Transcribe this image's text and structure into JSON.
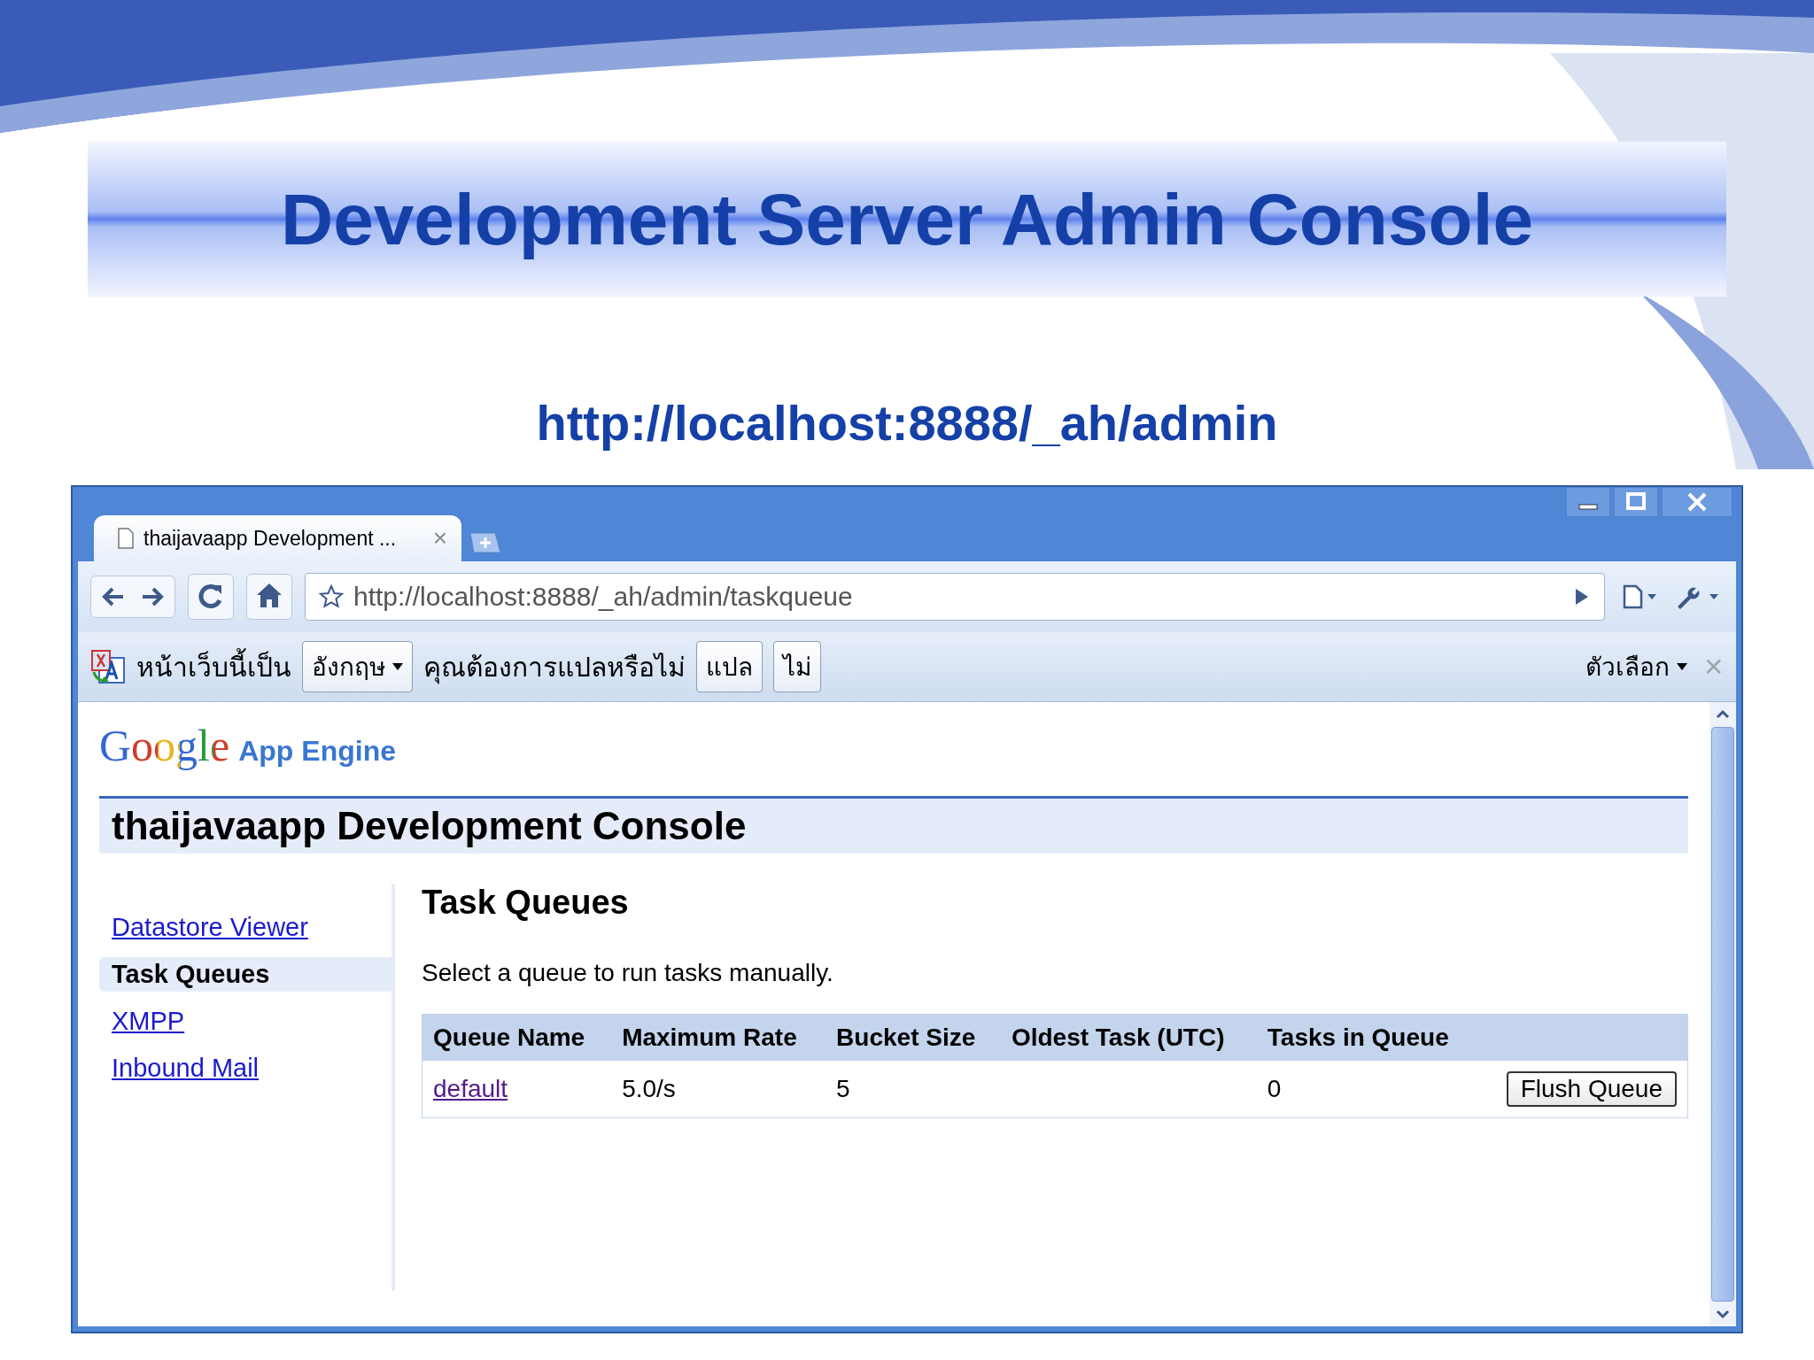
{
  "slide": {
    "title": "Development Server Admin Console",
    "subtitle": "http://localhost:8888/_ah/admin"
  },
  "browser": {
    "tab": {
      "title": "thaijavaapp Development ...",
      "close": "×"
    },
    "address": {
      "value": "http://localhost:8888/_ah/admin/taskqueue"
    },
    "translate_bar": {
      "prefix": "หน้าเว็บนี้เป็น",
      "language": "อังกฤษ",
      "question": "คุณต้องการแปลหรือไม่",
      "buttons": [
        "แปล",
        "ไม่"
      ],
      "options": "ตัวเลือก",
      "close": "✕"
    }
  },
  "page": {
    "logo": {
      "brand": "Google",
      "product": "App Engine"
    },
    "header": "thaijavaapp Development Console",
    "nav": [
      {
        "label": "Datastore Viewer",
        "selected": false
      },
      {
        "label": "Task Queues",
        "selected": true
      },
      {
        "label": "XMPP",
        "selected": false
      },
      {
        "label": "Inbound Mail",
        "selected": false
      }
    ],
    "section_title": "Task Queues",
    "description": "Select a queue to run tasks manually.",
    "table": {
      "columns": [
        "Queue Name",
        "Maximum Rate",
        "Bucket Size",
        "Oldest Task (UTC)",
        "Tasks in Queue"
      ],
      "rows": [
        {
          "cells": [
            "default",
            "5.0/s",
            "5",
            "",
            "0"
          ],
          "action": "Flush Queue"
        }
      ]
    }
  }
}
